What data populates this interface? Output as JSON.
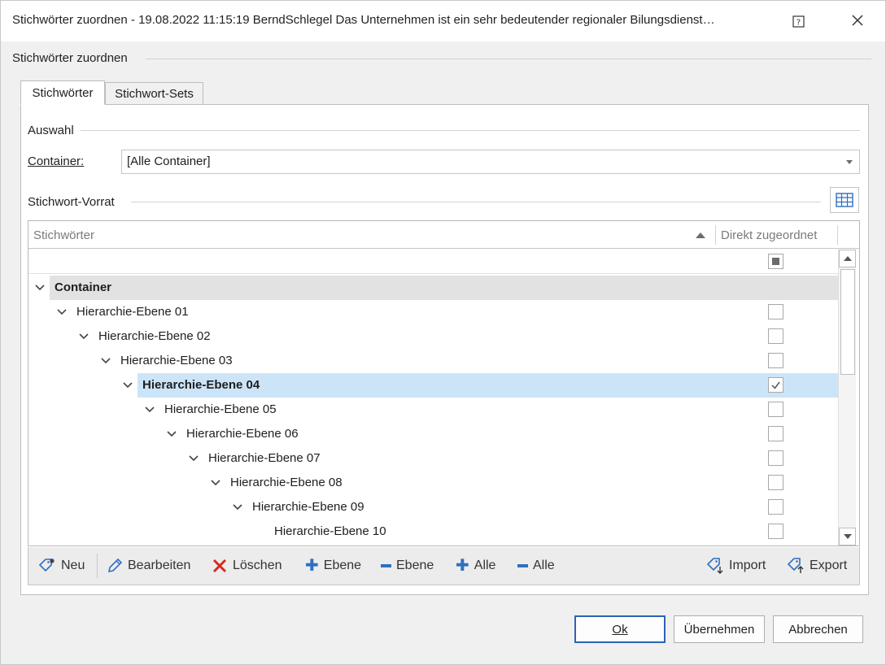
{
  "window": {
    "title": "Stichwörter zuordnen - 19.08.2022 11:15:19 BerndSchlegel Das Unternehmen ist ein sehr bedeutender regionaler Bilungsdienst…"
  },
  "groups": {
    "main_label": "Stichwörter zuordnen",
    "auswahl_label": "Auswahl",
    "vorrat_label": "Stichwort-Vorrat"
  },
  "tabs": [
    {
      "label": "Stichwörter",
      "active": true
    },
    {
      "label": "Stichwort-Sets",
      "active": false
    }
  ],
  "container": {
    "label": "Container:",
    "value": "[Alle Container]"
  },
  "grid": {
    "columns": [
      "Stichwörter",
      "Direkt zugeordnet"
    ],
    "rows": [
      {
        "label": "Container",
        "level": 0,
        "expanded": true,
        "bold": true,
        "group": true,
        "checked": null
      },
      {
        "label": "Hierarchie-Ebene 01",
        "level": 1,
        "expanded": true,
        "checked": false
      },
      {
        "label": "Hierarchie-Ebene 02",
        "level": 2,
        "expanded": true,
        "checked": false
      },
      {
        "label": "Hierarchie-Ebene 03",
        "level": 3,
        "expanded": true,
        "checked": false
      },
      {
        "label": "Hierarchie-Ebene 04",
        "level": 4,
        "expanded": true,
        "bold": true,
        "selected": true,
        "checked": true
      },
      {
        "label": "Hierarchie-Ebene 05",
        "level": 5,
        "expanded": true,
        "checked": false
      },
      {
        "label": "Hierarchie-Ebene 06",
        "level": 6,
        "expanded": true,
        "checked": false
      },
      {
        "label": "Hierarchie-Ebene 07",
        "level": 7,
        "expanded": true,
        "checked": false
      },
      {
        "label": "Hierarchie-Ebene 08",
        "level": 8,
        "expanded": true,
        "checked": false
      },
      {
        "label": "Hierarchie-Ebene 09",
        "level": 9,
        "expanded": true,
        "checked": false
      },
      {
        "label": "Hierarchie-Ebene 10",
        "level": 10,
        "expanded": false,
        "checked": false
      }
    ]
  },
  "toolbar": {
    "neu": "Neu",
    "bearbeiten": "Bearbeiten",
    "loeschen": "Löschen",
    "ebene_plus": "Ebene",
    "ebene_minus": "Ebene",
    "alle_plus": "Alle",
    "alle_minus": "Alle",
    "import": "Import",
    "export": "Export"
  },
  "buttons": {
    "ok": "Ok",
    "uebernehmen": "Übernehmen",
    "abbrechen": "Abbrechen"
  },
  "colors": {
    "selection": "#cce4f7",
    "group_row": "#e2e2e2",
    "default_button_border": "#2a64b5",
    "delete_red": "#d9281e",
    "accent_blue": "#2f6fbf"
  }
}
